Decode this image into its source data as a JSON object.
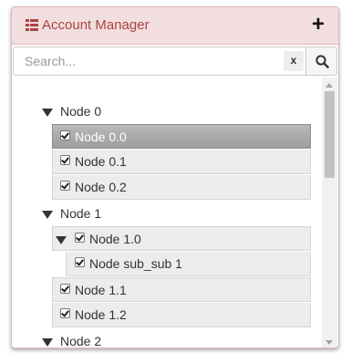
{
  "header": {
    "title": "Account Manager",
    "icon": "list-icon",
    "add_icon": "plus-icon",
    "add_label": "+"
  },
  "search": {
    "placeholder": "Search...",
    "value": "",
    "clear_label": "x",
    "button_icon": "search-icon"
  },
  "tree": {
    "nodes": [
      {
        "label": "Node 0",
        "level": 0,
        "expanded": true,
        "checkbox": false,
        "selected": false
      },
      {
        "label": "Node 0.0",
        "level": 1,
        "expanded": false,
        "checkbox": true,
        "checked": true,
        "selected": true
      },
      {
        "label": "Node 0.1",
        "level": 1,
        "expanded": false,
        "checkbox": true,
        "checked": true,
        "selected": false
      },
      {
        "label": "Node 0.2",
        "level": 1,
        "expanded": false,
        "checkbox": true,
        "checked": true,
        "selected": false
      },
      {
        "label": "Node 1",
        "level": 0,
        "expanded": true,
        "checkbox": false,
        "selected": false
      },
      {
        "label": "Node 1.0",
        "level": 1,
        "expanded": true,
        "checkbox": true,
        "checked": true,
        "selected": false
      },
      {
        "label": "Node sub_sub 1",
        "level": 2,
        "expanded": false,
        "checkbox": true,
        "checked": true,
        "selected": false
      },
      {
        "label": "Node 1.1",
        "level": 1,
        "expanded": false,
        "checkbox": true,
        "checked": true,
        "selected": false
      },
      {
        "label": "Node 1.2",
        "level": 1,
        "expanded": false,
        "checkbox": true,
        "checked": true,
        "selected": false
      },
      {
        "label": "Node 2",
        "level": 0,
        "expanded": true,
        "checkbox": false,
        "selected": false
      }
    ]
  },
  "colors": {
    "header_bg": "#f2dede",
    "header_text": "#a94442",
    "selected_bg": "#a9a9a9",
    "row_bg": "#ececec"
  }
}
